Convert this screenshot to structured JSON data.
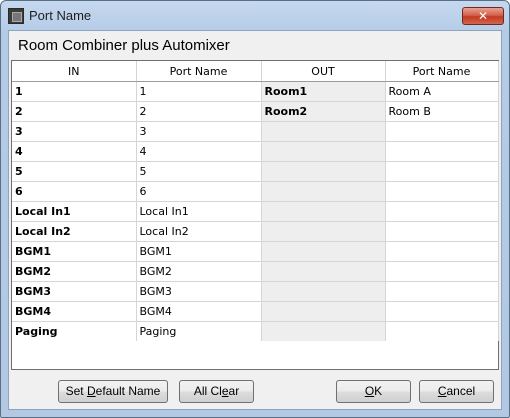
{
  "window": {
    "title": "Port Name",
    "close_glyph": "✕"
  },
  "heading": "Room Combiner plus Automixer",
  "table": {
    "columns": [
      "IN",
      "Port Name",
      "OUT",
      "Port Name"
    ],
    "rows": [
      {
        "in": "1",
        "in_name": "1",
        "out": "Room1",
        "out_name": "Room A"
      },
      {
        "in": "2",
        "in_name": "2",
        "out": "Room2",
        "out_name": "Room B"
      },
      {
        "in": "3",
        "in_name": "3",
        "out": "",
        "out_name": ""
      },
      {
        "in": "4",
        "in_name": "4",
        "out": "",
        "out_name": ""
      },
      {
        "in": "5",
        "in_name": "5",
        "out": "",
        "out_name": ""
      },
      {
        "in": "6",
        "in_name": "6",
        "out": "",
        "out_name": ""
      },
      {
        "in": "Local In1",
        "in_name": "Local In1",
        "out": "",
        "out_name": ""
      },
      {
        "in": "Local In2",
        "in_name": "Local In2",
        "out": "",
        "out_name": ""
      },
      {
        "in": "BGM1",
        "in_name": "BGM1",
        "out": "",
        "out_name": ""
      },
      {
        "in": "BGM2",
        "in_name": "BGM2",
        "out": "",
        "out_name": ""
      },
      {
        "in": "BGM3",
        "in_name": "BGM3",
        "out": "",
        "out_name": ""
      },
      {
        "in": "BGM4",
        "in_name": "BGM4",
        "out": "",
        "out_name": ""
      },
      {
        "in": "Paging",
        "in_name": "Paging",
        "out": "",
        "out_name": ""
      }
    ]
  },
  "buttons": {
    "set_default": {
      "pre": "Set ",
      "accel": "D",
      "post": "efault Name"
    },
    "all_clear": {
      "pre": "All Cl",
      "accel": "e",
      "post": "ar"
    },
    "ok": {
      "pre": "",
      "accel": "O",
      "post": "K"
    },
    "cancel": {
      "pre": "",
      "accel": "C",
      "post": "ancel"
    }
  },
  "colors": {
    "title_bar": "#b9cfea",
    "close_button": "#c94a33",
    "grid_out_label_bg": "#eeeeee"
  }
}
